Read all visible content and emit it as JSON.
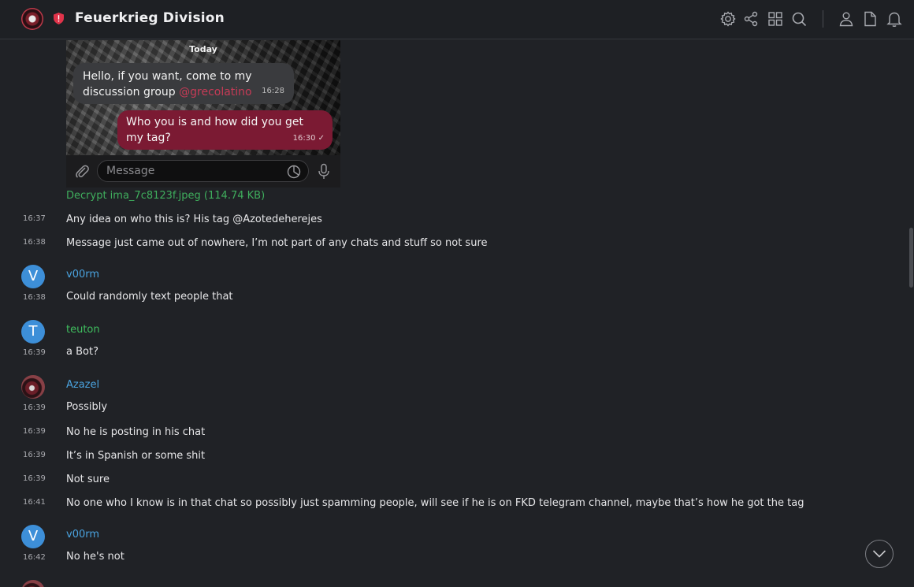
{
  "header": {
    "title": "Feuerkrieg Division",
    "icons": [
      "gear-icon",
      "share-icon",
      "grid-icon",
      "search-icon",
      "user-icon",
      "file-icon",
      "bell-icon"
    ]
  },
  "image_message": {
    "today_label": "Today",
    "incoming_text": "Hello, if you want, come to my discussion group",
    "incoming_mention": "@grecolatino",
    "incoming_time": "16:28",
    "outgoing_text": "Who you is and how did you get my tag?",
    "outgoing_time": "16:30",
    "composer_placeholder": "Message",
    "decrypt_link": "Decrypt ima_7c8123f.jpeg (114.74 KB)"
  },
  "messages": [
    {
      "time": "16:37",
      "text": "Any idea on who this is? His tag @Azotedeherejes"
    },
    {
      "time": "16:38",
      "text": "Message just came out of nowhere, I’m not part of any chats and stuff so not sure"
    },
    {
      "author": "v00rm",
      "initial": "V",
      "author_color": "#4aa3df",
      "time": "16:38",
      "text": "Could randomly text people that"
    },
    {
      "author": "teuton",
      "initial": "T",
      "author_color": "#3fbf5f",
      "time": "16:39",
      "text": "a Bot?"
    },
    {
      "author": "Azazel",
      "author_color": "#4aa3df",
      "time": "16:39",
      "text": "Possibly"
    },
    {
      "time": "16:39",
      "text": "No he is posting in his chat"
    },
    {
      "time": "16:39",
      "text": "It’s in Spanish or some shit"
    },
    {
      "time": "16:39",
      "text": "Not sure"
    },
    {
      "time": "16:41",
      "text": "No one who I know is in that chat so possibly just spamming people, will see if he is on FKD telegram channel, maybe that’s how he got the tag"
    },
    {
      "author": "v00rm",
      "initial": "V",
      "author_color": "#4aa3df",
      "time": "16:42",
      "text": "No he's not"
    }
  ],
  "colors": {
    "background": "#202226",
    "link_green": "#3fae5d",
    "avatar_blue": "#3d8fd8"
  }
}
